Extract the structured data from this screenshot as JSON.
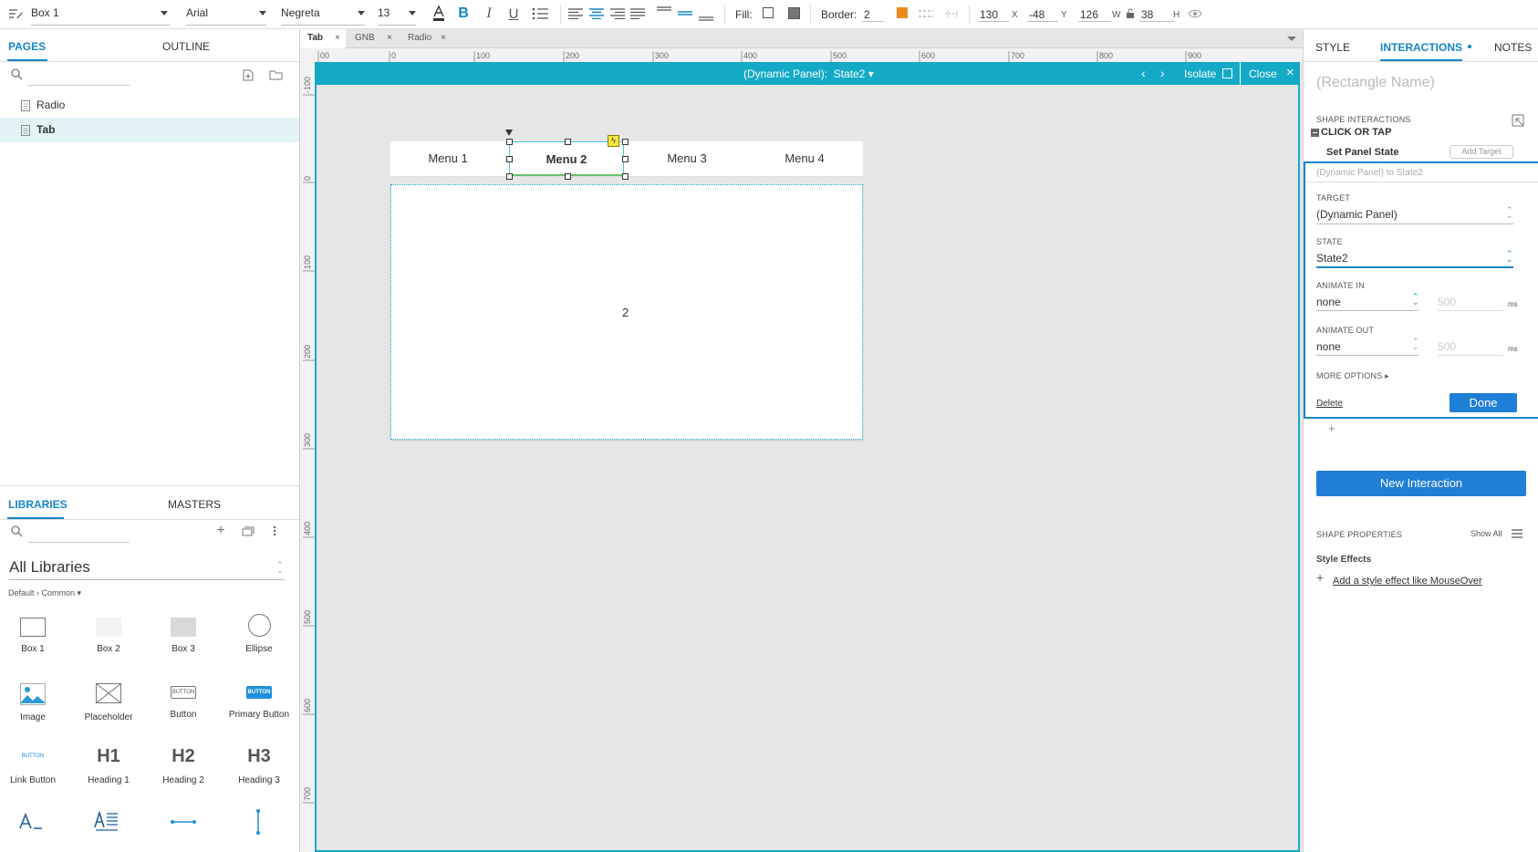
{
  "toolbar": {
    "shape_name": "Box 1",
    "font": "Arial",
    "weight": "Negreta",
    "size": "13",
    "fill_label": "Fill:",
    "border_label": "Border:",
    "border_value": "2",
    "x": "130",
    "x_label": "X",
    "y": "-48",
    "y_label": "Y",
    "w": "126",
    "w_label": "W",
    "h": "38",
    "h_label": "H"
  },
  "left": {
    "tabs": {
      "pages": "PAGES",
      "outline": "OUTLINE"
    },
    "pages": [
      {
        "label": "Radio"
      },
      {
        "label": "Tab"
      }
    ],
    "lib_tabs": {
      "libraries": "LIBRARIES",
      "masters": "MASTERS"
    },
    "library_select": "All Libraries",
    "breadcrumb": "Default › Common ▾",
    "widgets": [
      {
        "label": "Box 1"
      },
      {
        "label": "Box 2"
      },
      {
        "label": "Box 3"
      },
      {
        "label": "Ellipse"
      },
      {
        "label": "Image"
      },
      {
        "label": "Placeholder"
      },
      {
        "label": "Button"
      },
      {
        "label": "Primary Button"
      },
      {
        "label": "Link Button"
      },
      {
        "label": "Heading 1"
      },
      {
        "label": "Heading 2"
      },
      {
        "label": "Heading 3"
      }
    ],
    "widget_glyphs": {
      "button": "BUTTON",
      "primary": "BUTTON",
      "link": "BUTTON",
      "h1": "H1",
      "h2": "H2",
      "h3": "H3"
    }
  },
  "doc_tabs": [
    {
      "label": "Tab"
    },
    {
      "label": "GNB"
    },
    {
      "label": "Radio"
    }
  ],
  "ruler": {
    "h": [
      "00",
      "0",
      "100",
      "200",
      "300",
      "400",
      "500",
      "600",
      "700",
      "800",
      "900"
    ],
    "v": [
      "-100",
      "0",
      "100",
      "200",
      "300",
      "400",
      "500",
      "600",
      "700"
    ]
  },
  "panel_bar": {
    "title": "(Dynamic Panel):  State2 ▾",
    "isolate": "Isolate",
    "close": "Close"
  },
  "canvas": {
    "menus": [
      "Menu 1",
      "Menu 2",
      "Menu 3",
      "Menu 4"
    ],
    "content": "2"
  },
  "right": {
    "tabs": {
      "style": "STYLE",
      "interactions": "INTERACTIONS",
      "notes": "NOTES"
    },
    "name_placeholder": "(Rectangle Name)",
    "shape_interactions": "SHAPE INTERACTIONS",
    "event": "CLICK OR TAP",
    "action": "Set Panel State",
    "add_target": "Add Target",
    "summary": "(Dynamic Panel) to State2",
    "target_label": "TARGET",
    "target_value": "(Dynamic Panel)",
    "state_label": "STATE",
    "state_value": "State2",
    "animate_in_label": "ANIMATE IN",
    "animate_in": "none",
    "animate_in_ms": "500",
    "animate_out_label": "ANIMATE OUT",
    "animate_out": "none",
    "animate_out_ms": "500",
    "ms": "ms",
    "more_options": "MORE OPTIONS ▸",
    "delete": "Delete",
    "done": "Done",
    "plus": "+",
    "new_interaction": "New Interaction",
    "shape_properties": "SHAPE PROPERTIES",
    "show_all": "Show All",
    "style_effects": "Style Effects",
    "add_effect": "Add a style effect like MouseOver"
  },
  "colors": {
    "accent": "#1686c7",
    "panel_bar": "#14a9c7",
    "done": "#1f7ed6"
  }
}
